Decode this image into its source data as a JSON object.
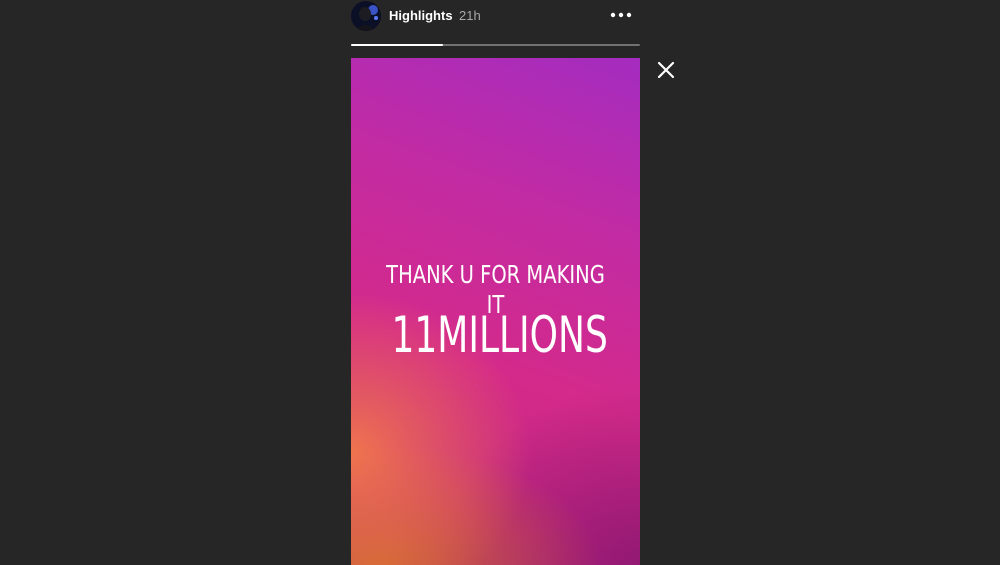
{
  "header": {
    "username": "Highlights",
    "timestamp": "21h",
    "avatar_icon": "profile-avatar-icon",
    "more_icon": "more-options-icon"
  },
  "progress": {
    "segments": 1,
    "fraction": 0.32
  },
  "story": {
    "line_one": "THANK U FOR MAKING IT",
    "line_two": "11MILLIONS",
    "gradient_colors": [
      "#a42cc0",
      "#d42a8a",
      "#f2784b",
      "#d26e28"
    ]
  },
  "close_icon": "close-icon",
  "colors": {
    "background": "#262626",
    "text": "#ffffff",
    "muted_text": "#a8a8a8"
  }
}
